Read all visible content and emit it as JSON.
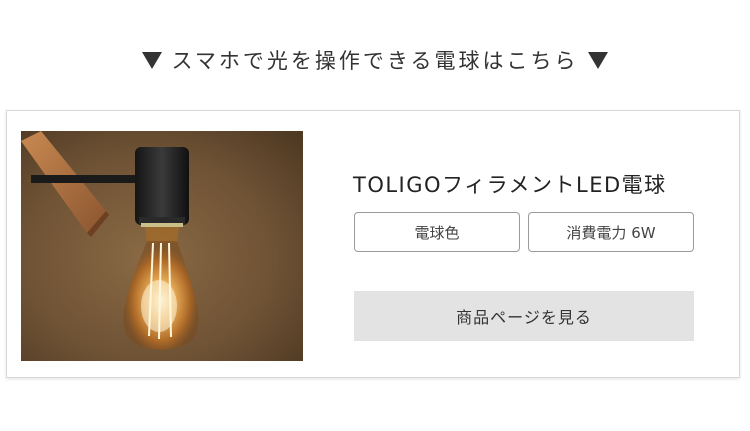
{
  "headline": {
    "text": "スマホで光を操作できる電球はこちら",
    "left_arrow_icon": "down-triangle-icon",
    "right_arrow_icon": "down-triangle-icon"
  },
  "product": {
    "name": "TOLIGOフィラメントLED電球",
    "tags": [
      "電球色",
      "消費電力 6W"
    ],
    "cta_label": "商品ページを見る",
    "photo_alt": "product-photo"
  },
  "colors": {
    "text": "#333333",
    "card_border": "#d8d8d8",
    "cta_background": "#e3e3e3",
    "tag_border": "#9a9a9a"
  }
}
